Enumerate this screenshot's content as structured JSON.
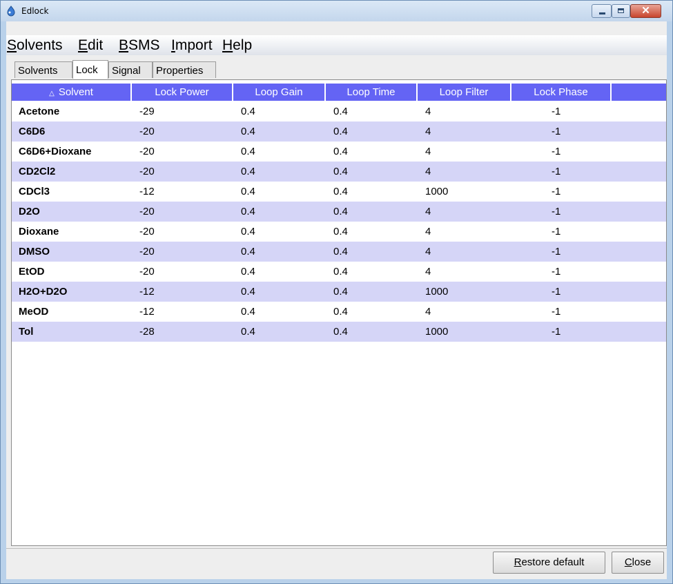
{
  "window": {
    "title": "Edlock",
    "close_glyph": "✕"
  },
  "menu": [
    {
      "mnemonic": "S",
      "rest": "olvents"
    },
    {
      "mnemonic": "E",
      "rest": "dit"
    },
    {
      "mnemonic": "B",
      "rest": "SMS"
    },
    {
      "mnemonic": "I",
      "rest": "mport"
    },
    {
      "mnemonic": "H",
      "rest": "elp"
    }
  ],
  "tabs": [
    "Solvents",
    "Lock",
    "Signal",
    "Properties"
  ],
  "active_tab": "Lock",
  "table": {
    "sort_indicator": "△",
    "columns": [
      "Solvent",
      "Lock Power",
      "Loop Gain",
      "Loop Time",
      "Loop Filter",
      "Lock Phase",
      ""
    ],
    "rows": [
      [
        "Acetone",
        "-29",
        "0.4",
        "0.4",
        "4",
        "-1"
      ],
      [
        "C6D6",
        "-20",
        "0.4",
        "0.4",
        "4",
        "-1"
      ],
      [
        "C6D6+Dioxane",
        "-20",
        "0.4",
        "0.4",
        "4",
        "-1"
      ],
      [
        "CD2Cl2",
        "-20",
        "0.4",
        "0.4",
        "4",
        "-1"
      ],
      [
        "CDCl3",
        "-12",
        "0.4",
        "0.4",
        "1000",
        "-1"
      ],
      [
        "D2O",
        "-20",
        "0.4",
        "0.4",
        "4",
        "-1"
      ],
      [
        "Dioxane",
        "-20",
        "0.4",
        "0.4",
        "4",
        "-1"
      ],
      [
        "DMSO",
        "-20",
        "0.4",
        "0.4",
        "4",
        "-1"
      ],
      [
        "EtOD",
        "-20",
        "0.4",
        "0.4",
        "4",
        "-1"
      ],
      [
        "H2O+D2O",
        "-12",
        "0.4",
        "0.4",
        "1000",
        "-1"
      ],
      [
        "MeOD",
        "-12",
        "0.4",
        "0.4",
        "4",
        "-1"
      ],
      [
        "Tol",
        "-28",
        "0.4",
        "0.4",
        "1000",
        "-1"
      ]
    ]
  },
  "buttons": {
    "restore": {
      "mnemonic": "R",
      "rest": "estore default"
    },
    "close": {
      "mnemonic": "C",
      "rest": "lose"
    }
  },
  "colors": {
    "header_bg": "#6464f4",
    "alt_row_bg": "#d5d5f7"
  }
}
